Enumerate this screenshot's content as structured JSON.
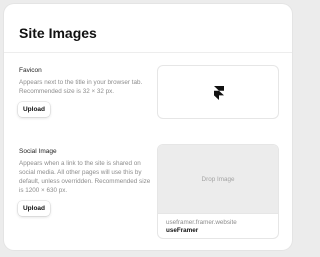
{
  "panel": {
    "title": "Site Images"
  },
  "favicon": {
    "title": "Favicon",
    "description": "Appears next to the title in your browser tab. Recommended size is 32 × 32 px.",
    "upload_label": "Upload",
    "preview_icon": "framer-logo-icon"
  },
  "social_image": {
    "title": "Social Image",
    "description": "Appears when a link to the site is shared on social media. All other pages will use this by default, unless overridden. Recommended size is 1200 × 630 px.",
    "upload_label": "Upload",
    "drop_label": "Drop Image",
    "preview_url": "useframer.framer.website",
    "preview_title": "useFramer"
  }
}
